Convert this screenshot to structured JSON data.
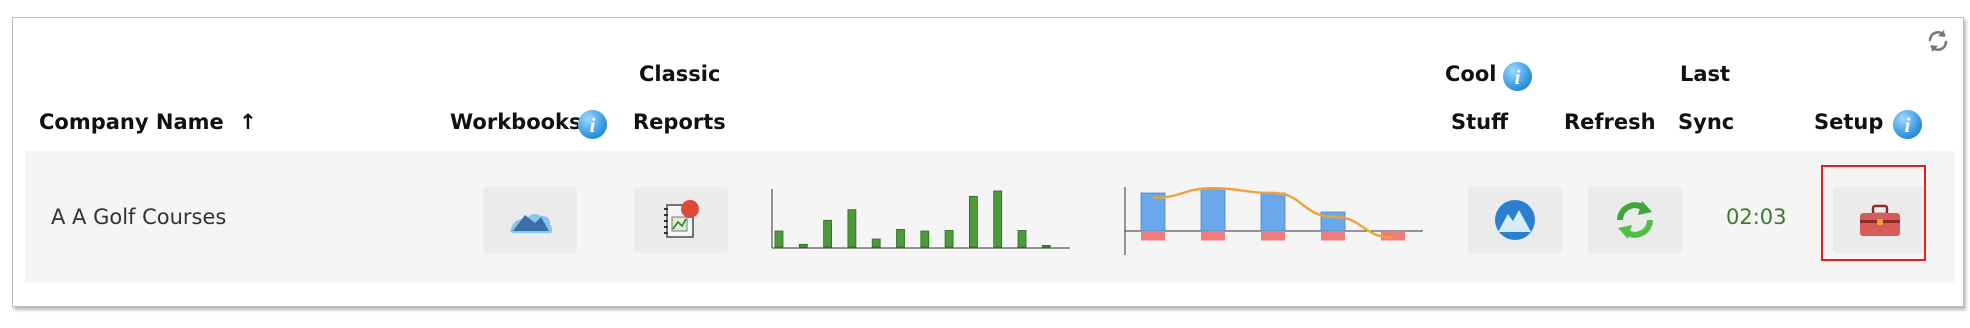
{
  "columns": {
    "company_name": "Company Name",
    "sort_arrow": "↑",
    "workbooks": "Workbooks",
    "classic_line1": "Classic",
    "classic_line2": "Reports",
    "cool_line1": "Cool",
    "cool_line2": "Stuff",
    "refresh": "Refresh",
    "last_line1": "Last",
    "last_line2": "Sync",
    "setup": "Setup"
  },
  "info_glyph": "i",
  "rows": [
    {
      "company": "A A Golf Courses",
      "last_sync": "02:03"
    }
  ],
  "icons": {
    "table_refresh": "refresh-icon",
    "workbooks": "workbook-cloud-icon",
    "classic_reports": "report-book-icon",
    "cool_stuff": "mountain-circle-icon",
    "refresh": "green-refresh-arrows-icon",
    "setup": "toolbox-icon",
    "info": "info-icon"
  },
  "colors": {
    "info_blue": "#2f93dc",
    "sync_green": "#3d7a2a",
    "highlight_red": "#e02323",
    "bar_green": "#4e9a3a",
    "waterfall_blue": "#6aa8ea",
    "waterfall_red": "#ef7b7b",
    "trend_orange": "#f0a23a"
  },
  "chart_data": [
    {
      "type": "bar",
      "values": [
        3,
        0.5,
        5,
        7,
        1.5,
        3.3,
        3,
        3.1,
        9.5,
        10.5,
        3.1,
        0.3
      ]
    },
    {
      "type": "bar",
      "positive": [
        4,
        4.5,
        4,
        2,
        0
      ],
      "negative": [
        -1,
        -1,
        -1,
        -1,
        -1
      ],
      "trend": [
        3.5,
        4.5,
        4,
        1.5,
        -0.7
      ]
    }
  ]
}
